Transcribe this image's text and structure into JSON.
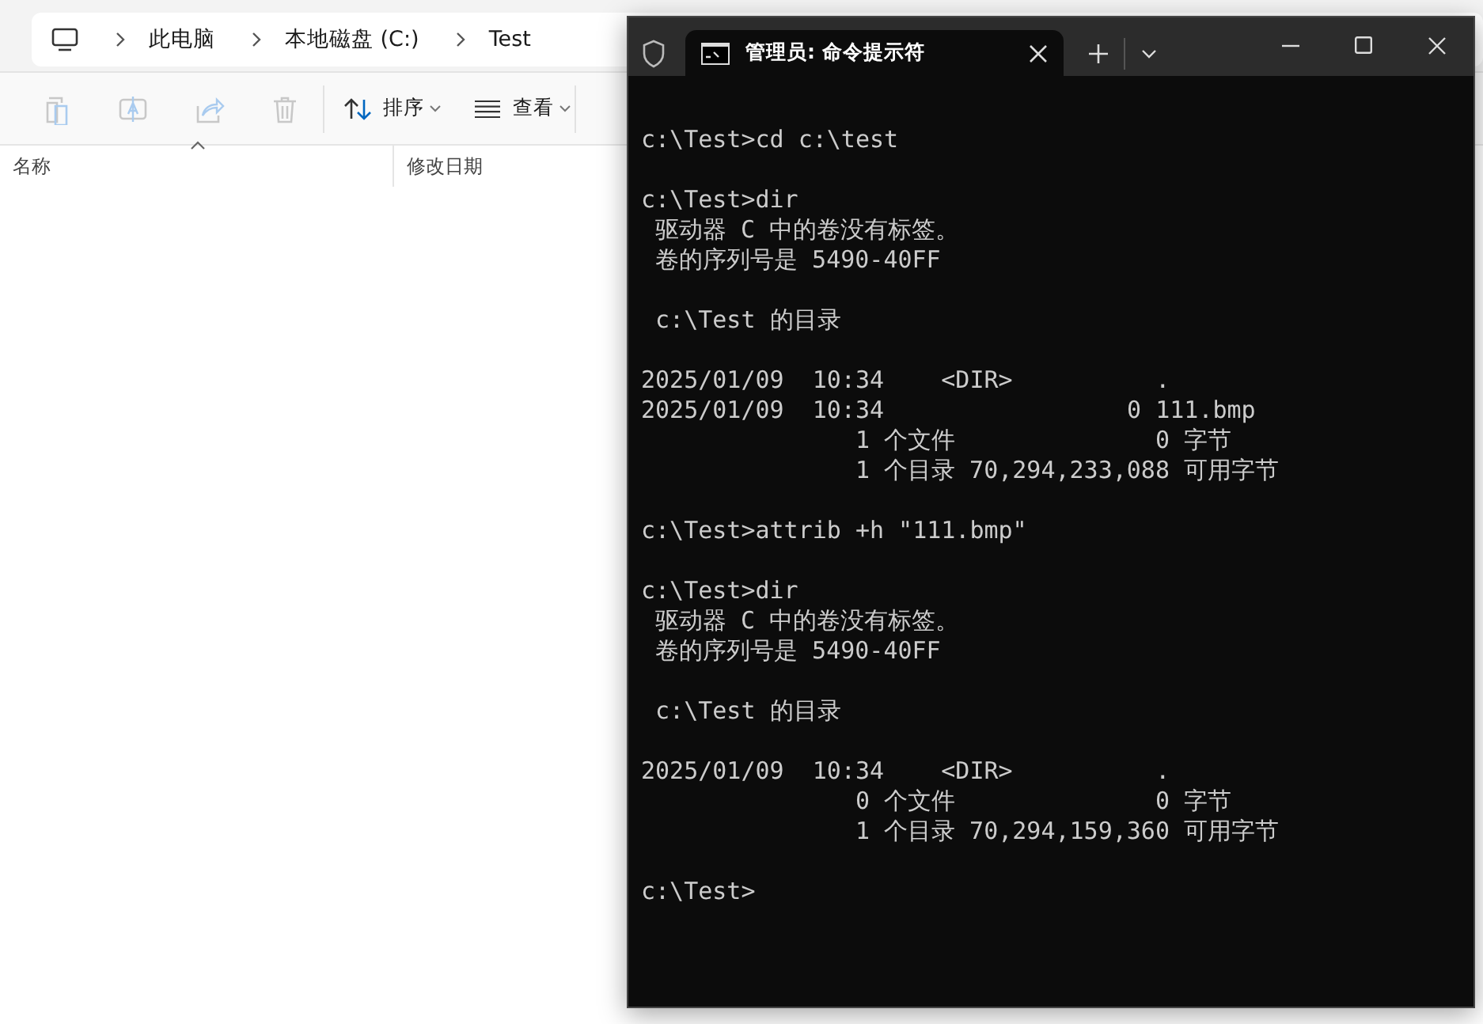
{
  "explorer": {
    "breadcrumb": [
      "此电脑",
      "本地磁盘 (C:)",
      "Test"
    ],
    "actions": [
      {
        "disabled": true
      },
      {
        "disabled": true
      },
      {
        "disabled": true
      },
      {
        "disabled": true
      }
    ],
    "menus": [
      {
        "label": "排序"
      },
      {
        "label": "查看"
      }
    ],
    "columns": [
      {
        "label": "名称",
        "sorted": true
      },
      {
        "label": "修改日期",
        "sorted": false
      }
    ]
  },
  "terminal": {
    "tab_title": "管理员: 命令提示符",
    "blocks": [
      [
        "c:\\Test>cd c:\\test"
      ],
      [
        "c:\\Test>dir",
        " 驱动器 C 中的卷没有标签。",
        " 卷的序列号是 5490-40FF"
      ],
      [
        " c:\\Test 的目录"
      ],
      [
        "2025/01/09  10:34    <DIR>          .",
        "2025/01/09  10:34                 0 111.bmp",
        "               1 个文件              0 字节",
        "               1 个目录 70,294,233,088 可用字节"
      ],
      [
        "c:\\Test>attrib +h \"111.bmp\""
      ],
      [
        "c:\\Test>dir",
        " 驱动器 C 中的卷没有标签。",
        " 卷的序列号是 5490-40FF"
      ],
      [
        " c:\\Test 的目录"
      ],
      [
        "2025/01/09  10:34    <DIR>          .",
        "               0 个文件              0 字节",
        "               1 个目录 70,294,159,360 可用字节"
      ],
      [
        "c:\\Test>"
      ]
    ]
  }
}
